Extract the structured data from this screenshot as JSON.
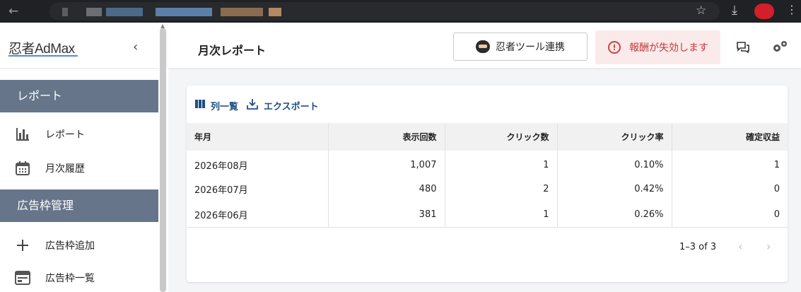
{
  "logo": {
    "text": "忍者AdMax"
  },
  "sidebar": {
    "sections": [
      {
        "label": "レポート",
        "items": [
          {
            "label": "レポート",
            "icon": "bar-chart-icon"
          },
          {
            "label": "月次履歴",
            "icon": "calendar-icon"
          }
        ]
      },
      {
        "label": "広告枠管理",
        "items": [
          {
            "label": "広告枠追加",
            "icon": "plus-icon"
          },
          {
            "label": "広告枠一覧",
            "icon": "list-window-icon"
          }
        ]
      }
    ]
  },
  "header": {
    "title": "月次レポート",
    "ninja_button": "忍者ツール連携",
    "alert": "報酬が失効します"
  },
  "toolbar": {
    "columns_label": "列一覧",
    "export_label": "エクスポート"
  },
  "table": {
    "headers": [
      "年月",
      "表示回数",
      "クリック数",
      "クリック率",
      "確定収益"
    ],
    "rows": [
      [
        "2026年08月",
        "1,007",
        "1",
        "0.10%",
        "1"
      ],
      [
        "2026年07月",
        "480",
        "2",
        "0.42%",
        "0"
      ],
      [
        "2026年06月",
        "381",
        "1",
        "0.26%",
        "0"
      ]
    ]
  },
  "pagination": {
    "label": "1–3 of 3"
  },
  "colors": {
    "accent": "#1f4f82",
    "section_bg": "#67758a",
    "alert_bg": "#fbeaea",
    "alert_text": "#c23b3b"
  }
}
